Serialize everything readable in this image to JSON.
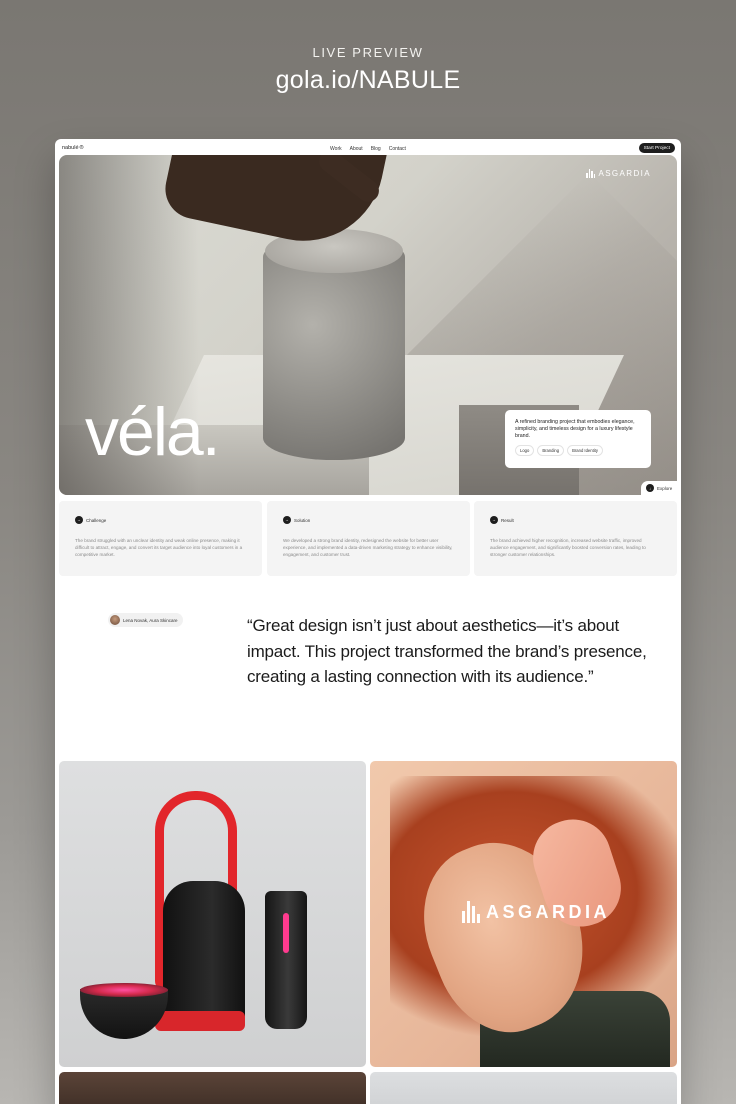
{
  "header": {
    "label": "LIVE PREVIEW",
    "url": "gola.io/NABULE"
  },
  "site": {
    "logo": "nabulé",
    "logo_mark": "®",
    "nav": [
      "Work",
      "About",
      "Blog",
      "Contact"
    ],
    "cta": "Start Project"
  },
  "hero": {
    "brand_logo": "ASGARDIA",
    "title": "véla.",
    "description": "A refined branding project that embodies elegance, simplicity, and timeless design for a luxury lifestyle brand.",
    "tags": [
      "Logo",
      "Branding",
      "Brand Identity"
    ],
    "explore": "Explore"
  },
  "cards": [
    {
      "label": "Challenge",
      "text": "The brand struggled with an unclear identity and weak online presence, making it difficult to attract, engage, and convert its target audience into loyal customers in a competitive market."
    },
    {
      "label": "Solution",
      "text": "We developed a strong brand identity, redesigned the website for better user experience, and implemented a data-driven marketing strategy to enhance visibility, engagement, and customer trust."
    },
    {
      "label": "Result",
      "text": "The brand achieved higher recognition, increased website traffic, improved audience engagement, and significantly boosted conversion rates, leading to stronger customer relationships."
    }
  ],
  "testimonial": {
    "author": "Lena Novak, Aura Skincare",
    "quote": "“Great design isn’t just about aesthetics—it’s about impact. This project transformed the brand’s presence, creating a lasting connection with its audience.”"
  },
  "gallery": {
    "portrait_logo": "ASGARDIA"
  }
}
